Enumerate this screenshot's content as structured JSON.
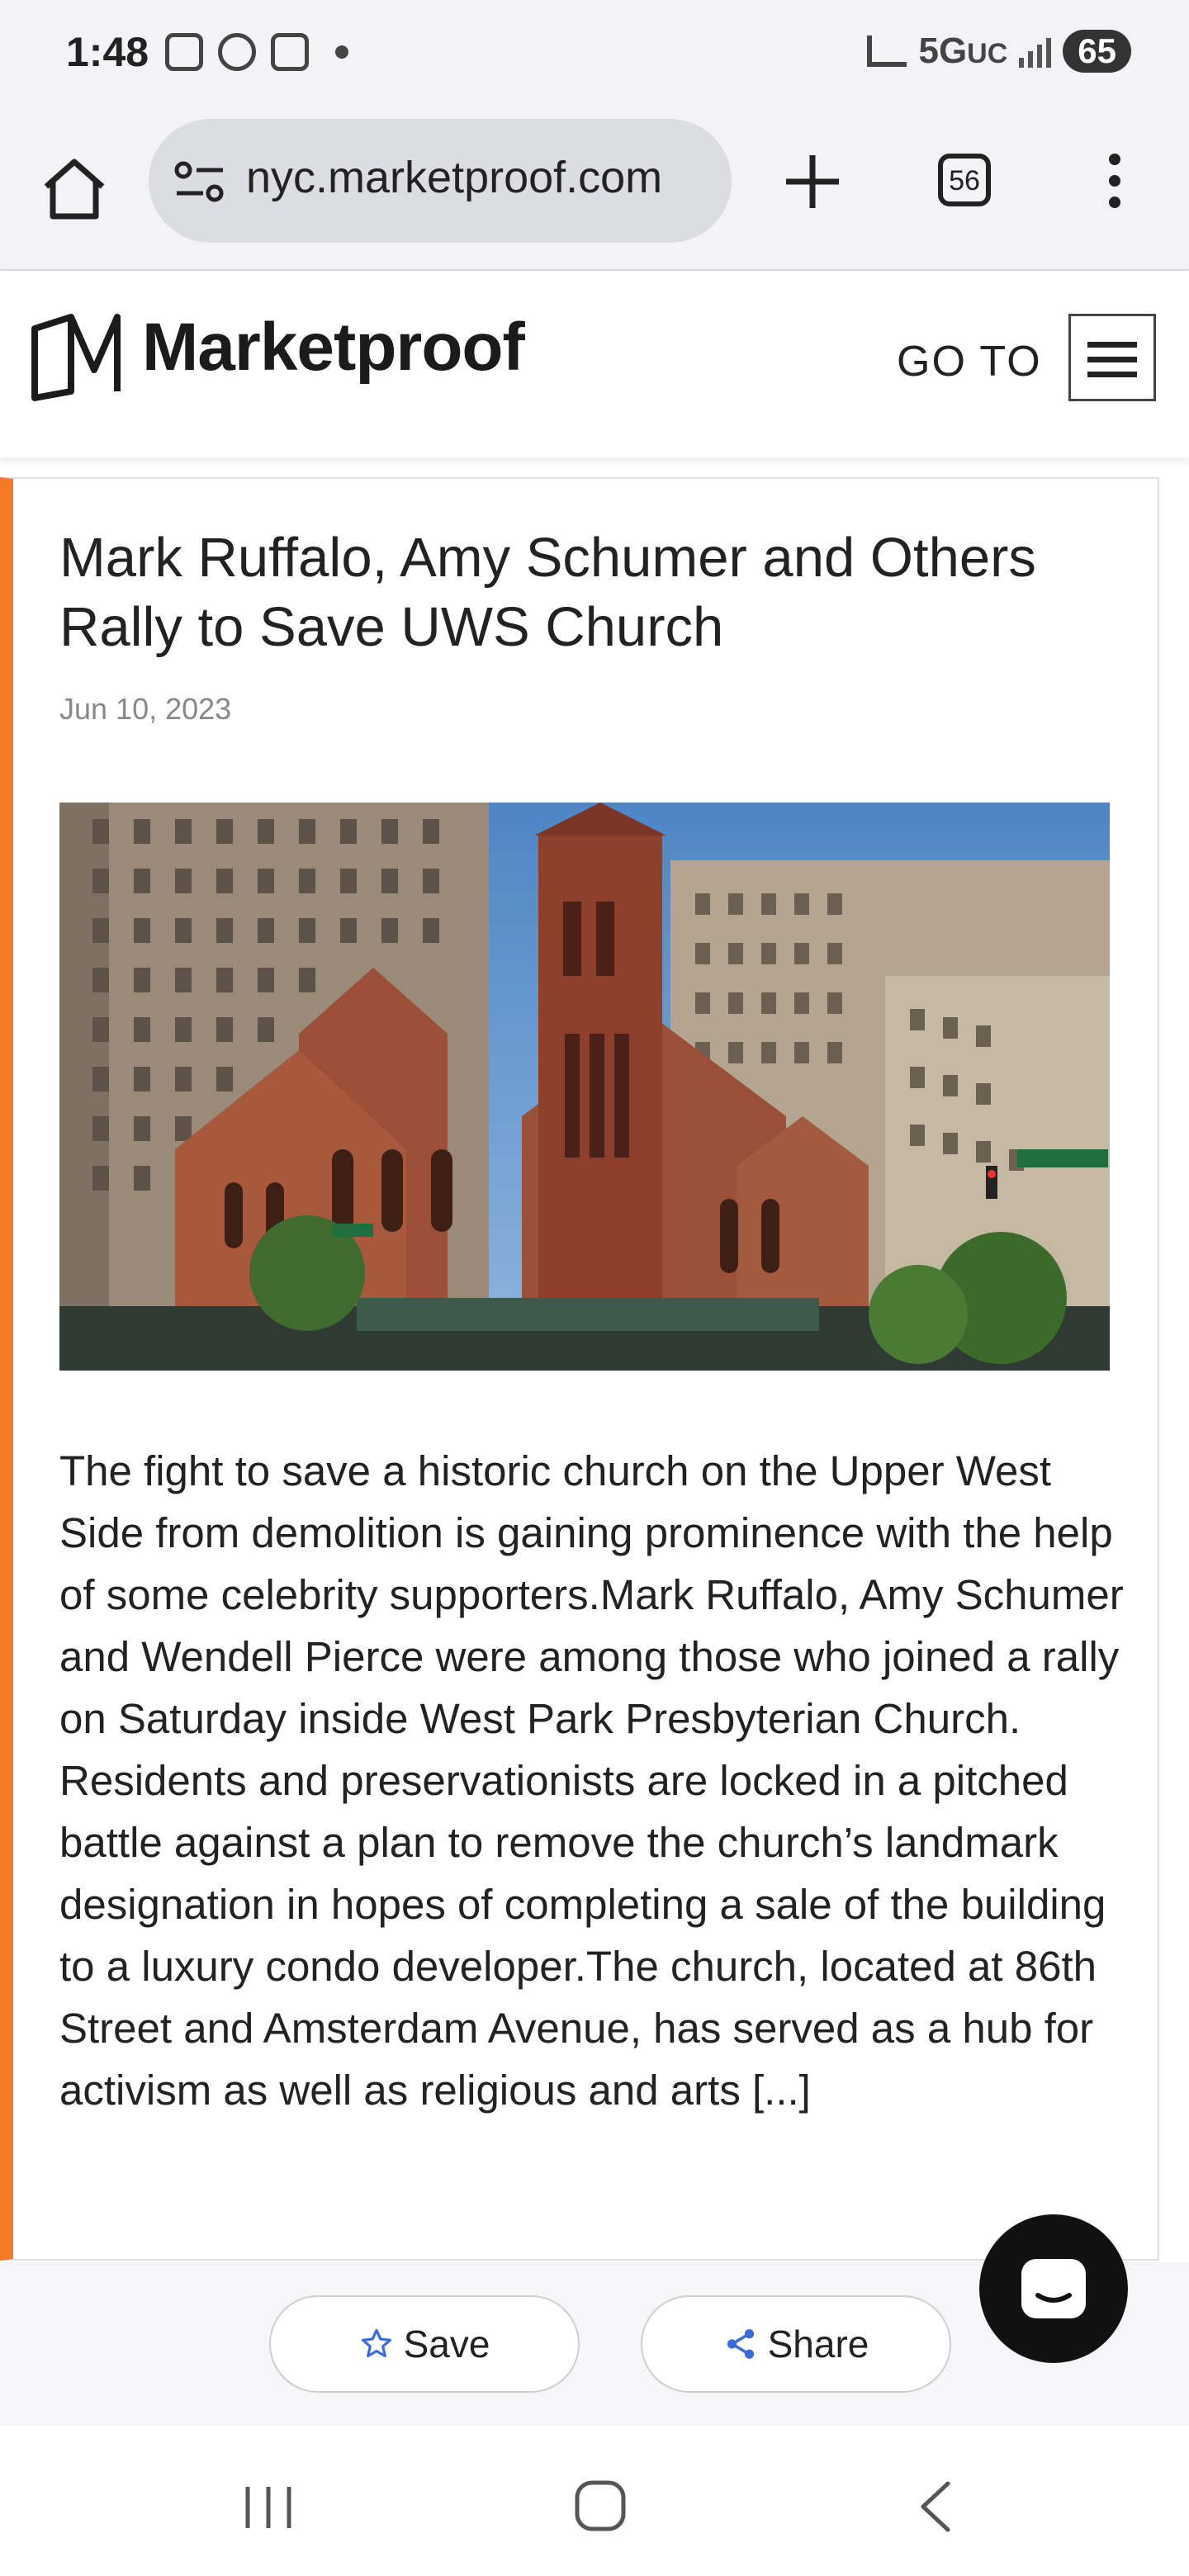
{
  "status_bar": {
    "time": "1:48",
    "network": "5G",
    "network_suffix": "UC",
    "battery": "65"
  },
  "browser": {
    "url": "nyc.marketproof.com",
    "tab_count": "56",
    "icons": [
      "home-icon",
      "site-settings-icon",
      "plus-icon",
      "tabs-icon",
      "more-vert-icon"
    ]
  },
  "site_header": {
    "logo_text": "Marketproof",
    "goto_label": "GO TO"
  },
  "article": {
    "title": "Mark Ruffalo, Amy Schumer and Others Rally to Save UWS Church",
    "date": "Jun 10, 2023",
    "image_alt": "",
    "body": "The fight to save a historic church on the Upper West Side from demolition is gaining prominence with the help of some celebrity supporters.Mark Ruffalo, Amy Schumer and Wendell Pierce were among those who joined a rally on Saturday inside West Park Presbyterian Church. Residents and preservationists are locked in a pitched battle against a plan to remove the church’s landmark designation in hopes of completing a sale of the building to a luxury condo developer.The church, located at 86th Street and Amsterdam Avenue, has served as a hub for activism as well as religious and arts [...]"
  },
  "actions": {
    "save_label": "Save",
    "share_label": "Share"
  },
  "colors": {
    "accent": "#f47a2a",
    "save_icon": "#3a6bd9",
    "share_icon": "#3a6bd9"
  }
}
